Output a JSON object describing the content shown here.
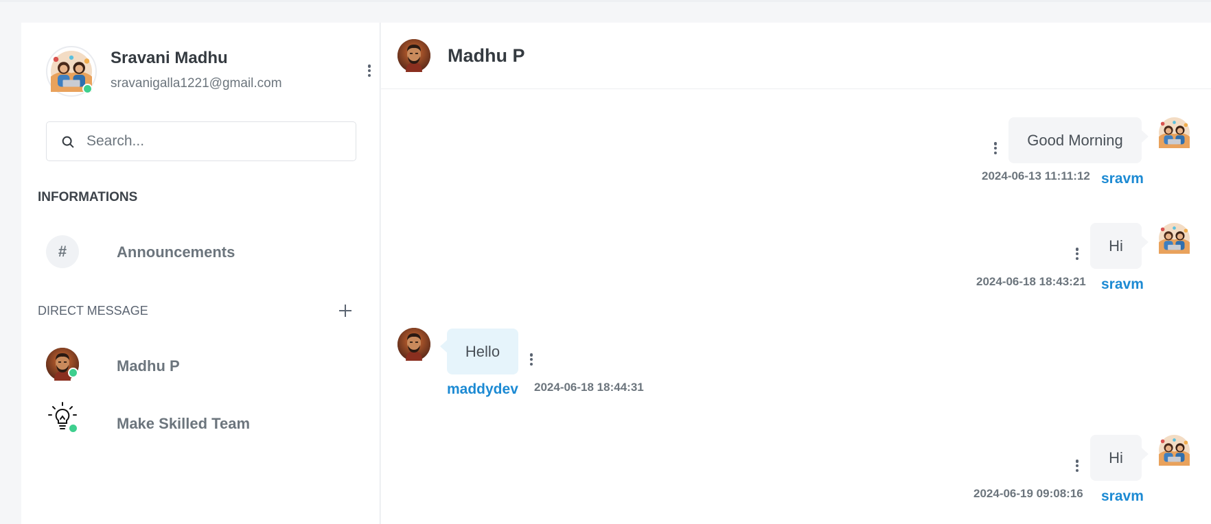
{
  "profile": {
    "name": "Sravani Madhu",
    "email": "sravanigalla1221@gmail.com",
    "online_color": "#3ecf8e"
  },
  "search": {
    "placeholder": "Search..."
  },
  "sections": {
    "informations": "INFORMATIONS",
    "direct_message": "DIRECT MESSAGE"
  },
  "channels": [
    {
      "icon": "#",
      "label": "Announcements"
    }
  ],
  "direct_messages": [
    {
      "label": "Madhu P",
      "icon": "user-avatar",
      "online": true
    },
    {
      "label": "Make Skilled Team",
      "icon": "lightbulb-icon",
      "online": true
    }
  ],
  "chat": {
    "title": "Madhu P",
    "messages": [
      {
        "direction": "out",
        "text": "Good Morning",
        "time": "2024-06-13 11:11:12",
        "user": "sravm"
      },
      {
        "direction": "out",
        "text": "Hi",
        "time": "2024-06-18 18:43:21",
        "user": "sravm"
      },
      {
        "direction": "in",
        "text": "Hello",
        "time": "2024-06-18 18:44:31",
        "user": "maddydev"
      },
      {
        "direction": "out",
        "text": "Hi",
        "time": "2024-06-19 09:08:16",
        "user": "sravm"
      }
    ]
  },
  "colors": {
    "accent": "#1c8ad3",
    "online": "#3ecf8e",
    "incoming_bubble": "#e6f4fb",
    "outgoing_bubble": "#f4f5f7"
  }
}
